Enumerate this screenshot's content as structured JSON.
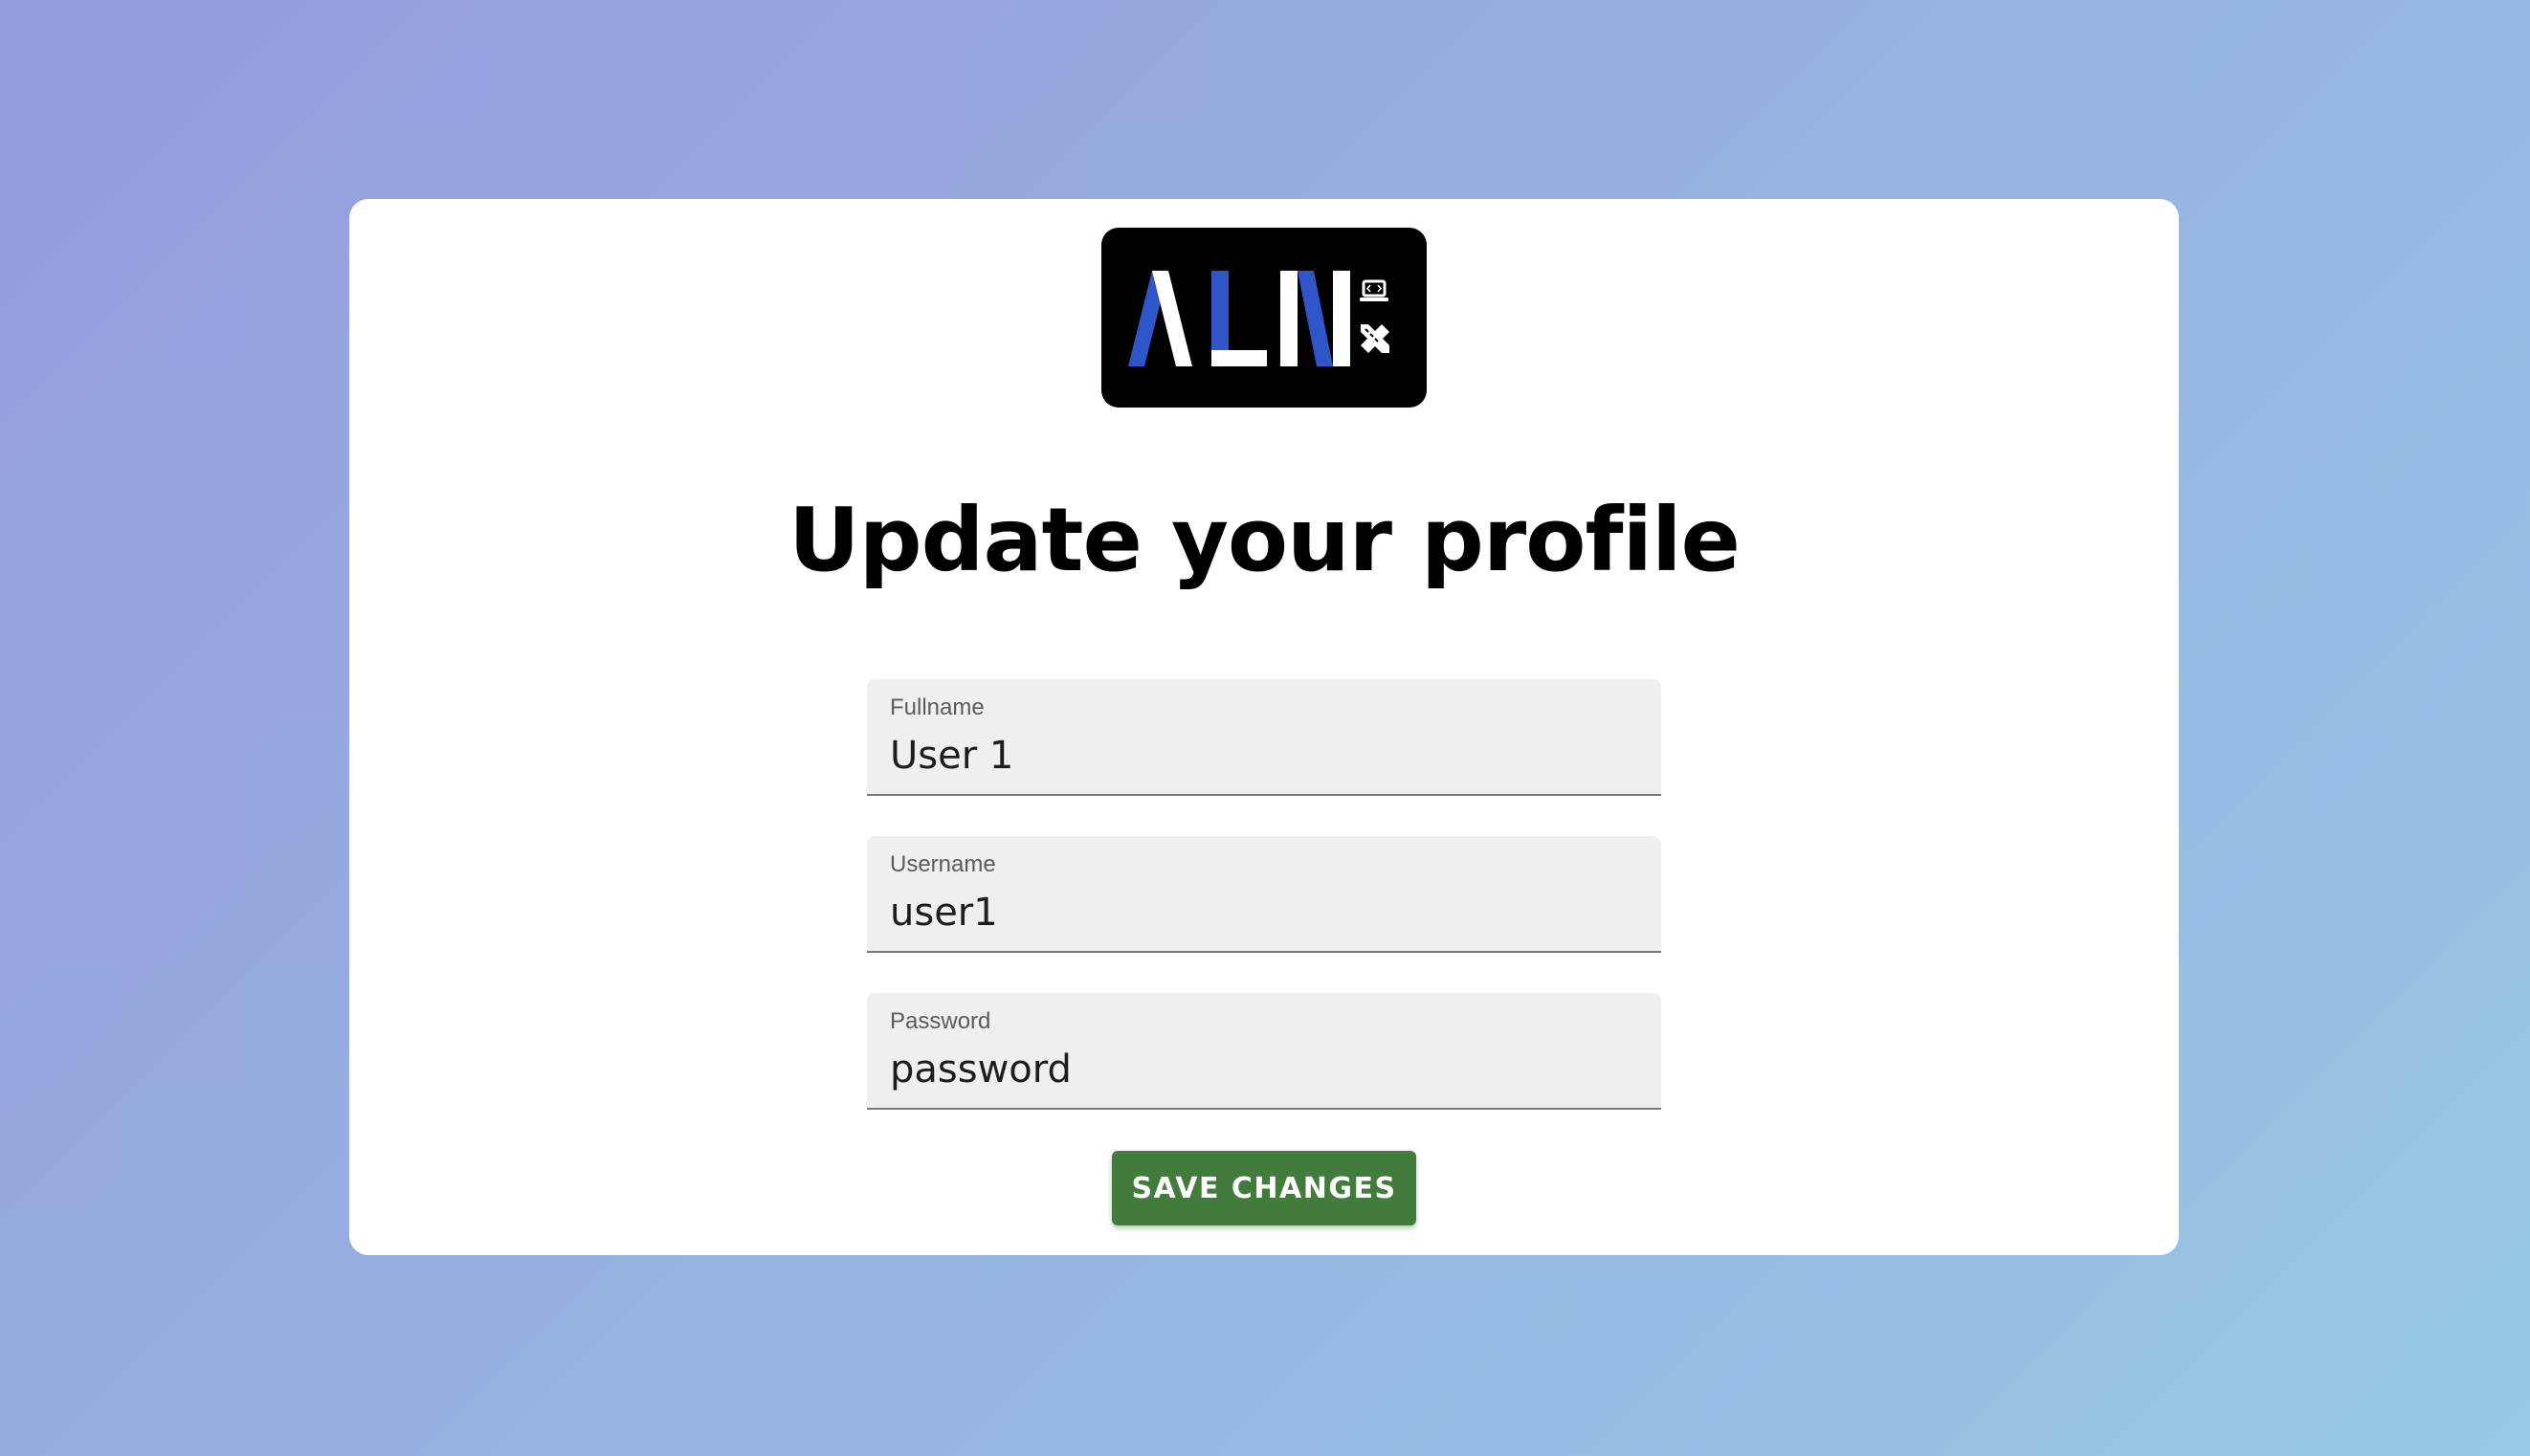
{
  "logo": {
    "text": "ALN",
    "icons": [
      "laptop-code-icon",
      "pencil-ruler-icon"
    ],
    "colors": {
      "background": "#000000",
      "white": "#ffffff",
      "blue": "#2f56c8"
    }
  },
  "form": {
    "title": "Update your profile",
    "fields": [
      {
        "label": "Fullname",
        "value": "User 1"
      },
      {
        "label": "Username",
        "value": "user1"
      },
      {
        "label": "Password",
        "value": "password"
      }
    ],
    "save_label": "SAVE CHANGES"
  },
  "colors": {
    "background_start": "#969cde",
    "background_end": "#98c8e6",
    "card": "#ffffff",
    "button": "#427c3d",
    "field_background": "#efefef"
  }
}
